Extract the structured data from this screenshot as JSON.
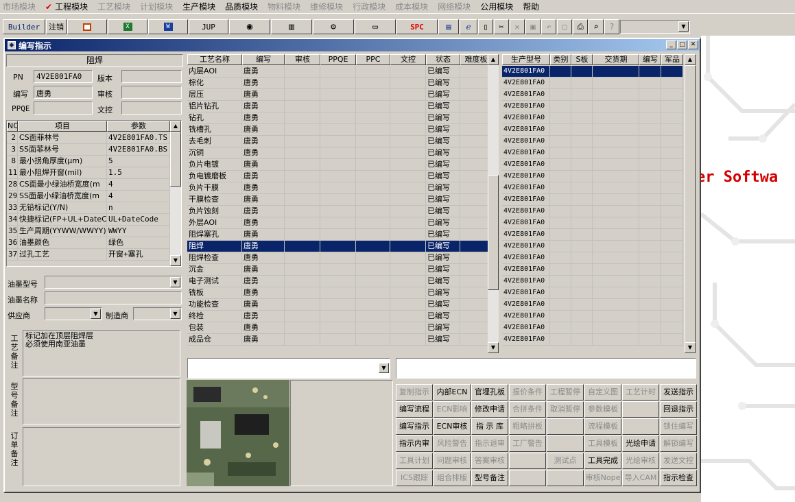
{
  "menu": [
    {
      "label": "市场模块",
      "enabled": false
    },
    {
      "label": "工程模块",
      "enabled": true,
      "checked": true
    },
    {
      "label": "工艺模块",
      "enabled": false
    },
    {
      "label": "计划模块",
      "enabled": false
    },
    {
      "label": "生产模块",
      "enabled": true
    },
    {
      "label": "品质模块",
      "enabled": true
    },
    {
      "label": "物料模块",
      "enabled": false
    },
    {
      "label": "维修模块",
      "enabled": false
    },
    {
      "label": "行政模块",
      "enabled": false
    },
    {
      "label": "成本模块",
      "enabled": false
    },
    {
      "label": "网络模块",
      "enabled": false
    },
    {
      "label": "公用模块",
      "enabled": true
    },
    {
      "label": "帮助",
      "enabled": true
    }
  ],
  "toolbar": {
    "builder": "Builder",
    "logout": "注销",
    "jup": "JUP",
    "spc": "SPC"
  },
  "window": {
    "title": "编写指示"
  },
  "left": {
    "section_title": "阻焊",
    "pn_label": "PN",
    "pn_value": "4V2E801FA0",
    "version_label": "版本",
    "version_value": "",
    "writer_label": "编写",
    "writer_value": "唐勇",
    "review_label": "审核",
    "review_value": "",
    "ppqe_label": "PPQE",
    "ppqe_value": "",
    "doc_label": "文控",
    "doc_value": "",
    "params_headers": [
      "NO",
      "项目",
      "参数"
    ],
    "params": [
      {
        "no": "2",
        "item": "CS面菲林号",
        "value": "4V2E801FA0.TS"
      },
      {
        "no": "3",
        "item": "SS面菲林号",
        "value": "4V2E801FA0.BS"
      },
      {
        "no": "8",
        "item": "最小拐角厚度(μm)",
        "value": "5"
      },
      {
        "no": "11",
        "item": "最小阻焊开窗(mil)",
        "value": "1.5"
      },
      {
        "no": "28",
        "item": "CS面最小绿油桥宽度(m",
        "value": "4"
      },
      {
        "no": "29",
        "item": "SS面最小绿油桥宽度(m",
        "value": "4"
      },
      {
        "no": "33",
        "item": "无铅标记(Y/N)",
        "value": "n"
      },
      {
        "no": "34",
        "item": "快捷标记(FP+UL+DateCo",
        "value": "UL+DateCode"
      },
      {
        "no": "35",
        "item": "生产周期(YYWW/WWYY)",
        "value": "WWYY"
      },
      {
        "no": "36",
        "item": "油墨颜色",
        "value": "绿色"
      },
      {
        "no": "37",
        "item": "过孔工艺",
        "value": "开窗+塞孔"
      }
    ],
    "ink_model_label": "油墨型号",
    "ink_model_value": "",
    "ink_name_label": "油墨名称",
    "ink_name_value": "",
    "supplier_label": "供应商",
    "supplier_value": "",
    "maker_label": "制造商",
    "maker_value": "",
    "process_note_label": "工艺备注",
    "process_note": [
      "标记加在顶层阻焊层",
      "必须使用南亚油墨"
    ],
    "model_note_label": "型号备注",
    "model_note": "",
    "order_note_label": "订单备注",
    "order_note": ""
  },
  "process": {
    "headers": [
      "工艺名称",
      "编写",
      "审核",
      "PPQE",
      "PPC",
      "文控",
      "状态",
      "难度板"
    ],
    "selected_index": 15,
    "rows": [
      {
        "name": "内层AOI",
        "writer": "唐勇",
        "status": "已编写"
      },
      {
        "name": "棕化",
        "writer": "唐勇",
        "status": "已编写"
      },
      {
        "name": "层压",
        "writer": "唐勇",
        "status": "已编写"
      },
      {
        "name": "铝片钻孔",
        "writer": "唐勇",
        "status": "已编写"
      },
      {
        "name": "钻孔",
        "writer": "唐勇",
        "status": "已编写"
      },
      {
        "name": "铣槽孔",
        "writer": "唐勇",
        "status": "已编写"
      },
      {
        "name": "去毛刺",
        "writer": "唐勇",
        "status": "已编写"
      },
      {
        "name": "沉铜",
        "writer": "唐勇",
        "status": "已编写"
      },
      {
        "name": "负片电镀",
        "writer": "唐勇",
        "status": "已编写"
      },
      {
        "name": "负电镀磨板",
        "writer": "唐勇",
        "status": "已编写"
      },
      {
        "name": "负片干膜",
        "writer": "唐勇",
        "status": "已编写"
      },
      {
        "name": "干膜检查",
        "writer": "唐勇",
        "status": "已编写"
      },
      {
        "name": "负片蚀刻",
        "writer": "唐勇",
        "status": "已编写"
      },
      {
        "name": "外层AOI",
        "writer": "唐勇",
        "status": "已编写"
      },
      {
        "name": "阻焊塞孔",
        "writer": "唐勇",
        "status": "已编写"
      },
      {
        "name": "阻焊",
        "writer": "唐勇",
        "status": "已编写"
      },
      {
        "name": "阻焊检查",
        "writer": "唐勇",
        "status": "已编写"
      },
      {
        "name": "沉金",
        "writer": "唐勇",
        "status": "已编写"
      },
      {
        "name": "电子测试",
        "writer": "唐勇",
        "status": "已编写"
      },
      {
        "name": "铣板",
        "writer": "唐勇",
        "status": "已编写"
      },
      {
        "name": "功能检查",
        "writer": "唐勇",
        "status": "已编写"
      },
      {
        "name": "终检",
        "writer": "唐勇",
        "status": "已编写"
      },
      {
        "name": "包装",
        "writer": "唐勇",
        "status": "已编写"
      },
      {
        "name": "成品仓",
        "writer": "唐勇",
        "status": "已编写"
      }
    ]
  },
  "models": {
    "headers": [
      "生产型号",
      "类别",
      "S板",
      "交货期",
      "编写",
      "军品"
    ],
    "selected_index": 0,
    "rows": [
      "4V2E801FA0",
      "4V2E801FA0",
      "4V2E801FA0",
      "4V2E801FA0",
      "4V2E801FA0",
      "4V2E801FA0",
      "4V2E801FA0",
      "4V2E801FA0",
      "4V2E801FA0",
      "4V2E801FA0",
      "4V2E801FA0",
      "4V2E801FA0",
      "4V2E801FA0",
      "4V2E801FA0",
      "4V2E801FA0",
      "4V2E801FA0",
      "4V2E801FA0",
      "4V2E801FA0",
      "4V2E801FA0",
      "4V2E801FA0",
      "4V2E801FA0",
      "4V2E801FA0",
      "4V2E801FA0",
      "4V2E801FA0"
    ]
  },
  "actions": [
    [
      {
        "label": "复制指示",
        "enabled": false
      },
      {
        "label": "内部ECN",
        "enabled": true
      },
      {
        "label": "官埋孔板",
        "enabled": true
      },
      {
        "label": "报价条件",
        "enabled": false
      },
      {
        "label": "工程暂停",
        "enabled": false
      },
      {
        "label": "自定义图",
        "enabled": false
      },
      {
        "label": "工艺计时",
        "enabled": false
      },
      {
        "label": "发送指示",
        "enabled": true
      }
    ],
    [
      {
        "label": "编写流程",
        "enabled": true
      },
      {
        "label": "ECN影响",
        "enabled": false
      },
      {
        "label": "修改申请",
        "enabled": true
      },
      {
        "label": "合拼条件",
        "enabled": false
      },
      {
        "label": "取消暂停",
        "enabled": false
      },
      {
        "label": "参数模板",
        "enabled": false
      },
      {
        "label": "",
        "enabled": false
      },
      {
        "label": "回退指示",
        "enabled": true
      }
    ],
    [
      {
        "label": "编写指示",
        "enabled": true
      },
      {
        "label": "ECN审核",
        "enabled": true
      },
      {
        "label": "指 示 库",
        "enabled": true
      },
      {
        "label": "粗略拼板",
        "enabled": false
      },
      {
        "label": "",
        "enabled": false
      },
      {
        "label": "流程模板",
        "enabled": false
      },
      {
        "label": "",
        "enabled": false
      },
      {
        "label": "锁住编写",
        "enabled": false
      }
    ],
    [
      {
        "label": "指示内审",
        "enabled": true
      },
      {
        "label": "风险警告",
        "enabled": false
      },
      {
        "label": "指示退审",
        "enabled": false
      },
      {
        "label": "工厂警告",
        "enabled": false
      },
      {
        "label": "",
        "enabled": false
      },
      {
        "label": "工具模板",
        "enabled": false
      },
      {
        "label": "光绘申请",
        "enabled": true
      },
      {
        "label": "解锁编写",
        "enabled": false
      }
    ],
    [
      {
        "label": "工具计划",
        "enabled": false
      },
      {
        "label": "问题审核",
        "enabled": false
      },
      {
        "label": "答案审核",
        "enabled": false
      },
      {
        "label": "",
        "enabled": false
      },
      {
        "label": "测试点",
        "enabled": false
      },
      {
        "label": "工具完成",
        "enabled": true
      },
      {
        "label": "光绘审核",
        "enabled": false
      },
      {
        "label": "发送文控",
        "enabled": false
      }
    ],
    [
      {
        "label": "ICS跟踪",
        "enabled": false
      },
      {
        "label": "组合排版",
        "enabled": false
      },
      {
        "label": "型号备注",
        "enabled": true
      },
      {
        "label": "",
        "enabled": false
      },
      {
        "label": "",
        "enabled": false
      },
      {
        "label": "审核Nope",
        "enabled": false
      },
      {
        "label": "导入CAM",
        "enabled": false
      },
      {
        "label": "指示检查",
        "enabled": true
      }
    ]
  ],
  "background_text": "er Softwa",
  "colors": {
    "selection": "#0a246a",
    "title_gradient_start": "#0a246a",
    "title_gradient_end": "#a6caf0",
    "menu_check": "#e00000",
    "background_text": "#d40000"
  }
}
